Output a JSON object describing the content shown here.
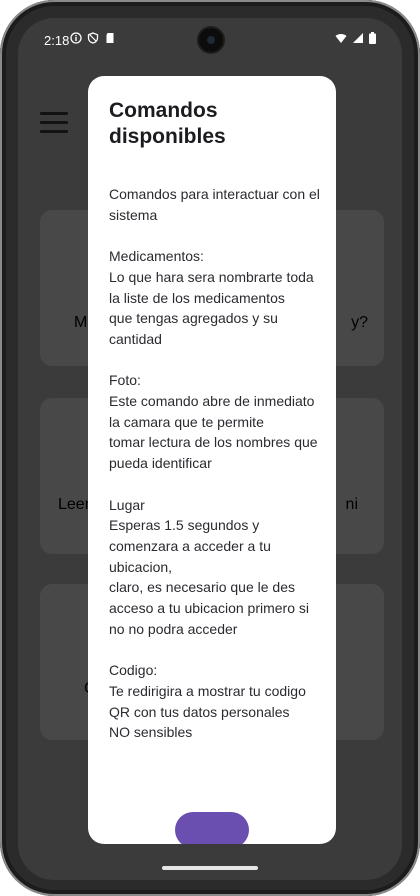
{
  "status_bar": {
    "time": "2:18",
    "icons": [
      "info-icon",
      "shield-icon",
      "sd-card-icon"
    ],
    "right_icons": [
      "wifi-icon",
      "signal-icon",
      "battery-icon"
    ]
  },
  "background": {
    "cards": [
      {
        "left_text": "Me",
        "right_text": "y?"
      },
      {
        "left_text": "Leer",
        "right_text": "ni"
      },
      {
        "left_text": "C",
        "right_text": ""
      }
    ]
  },
  "dialog": {
    "title": "Comandos disponibles",
    "body": "Comandos para interactuar con el sistema\n\nMedicamentos:\nLo que hara sera nombrarte toda la liste de los medicamentos\nque tengas agregados y su cantidad\n\nFoto:\nEste comando abre de inmediato la camara que te permite\ntomar lectura de los nombres que pueda identificar\n\nLugar\nEsperas 1.5 segundos y comenzara a acceder a tu ubicacion,\nclaro, es necesario que le des acceso a tu ubicacion primero si no no podra acceder\n\nCodigo:\nTe redirigira a mostrar tu codigo QR con tus datos personales\nNO sensibles"
  },
  "colors": {
    "scrim": "#3b3b3b",
    "dialog_bg": "#ffffff",
    "button": "#6b4fb0"
  }
}
